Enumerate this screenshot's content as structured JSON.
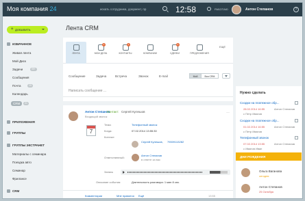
{
  "header": {
    "logo_text": "Моя компания",
    "logo_number": "24",
    "search_placeholder": "искать сотрудника, документ, пр",
    "time": "12:58",
    "work_status": "РАБОТАЮ",
    "user_name": "Антон Степанов",
    "help_glyph": "?"
  },
  "sidebar": {
    "add_button": "ДОБАВИТЬ",
    "favorites_label": "ИЗБРАННОЕ",
    "items": [
      {
        "label": "Живая лента"
      },
      {
        "label": "Мой Диск"
      },
      {
        "label": "Задачи",
        "badge": "99+"
      },
      {
        "label": "Сообщения"
      },
      {
        "label": "Почта",
        "badge": "19"
      },
      {
        "label": "Календарь"
      }
    ],
    "active_item": "CRM",
    "active_badge": "21",
    "groups": [
      {
        "label": "ПРИЛОЖЕНИЯ"
      },
      {
        "label": "ГРУППЫ"
      },
      {
        "label": "ГРУППЫ ЭКСТРАНЕТ"
      }
    ],
    "extranet_items": [
      {
        "label": "Материалы с семинара"
      },
      {
        "label": "Поездка авто"
      },
      {
        "label": "Семинар"
      },
      {
        "label": "Фрилансе"
      }
    ],
    "crm_group": "CRM"
  },
  "main": {
    "title": "Лента CRM",
    "toolbar": [
      {
        "label": "ЛЕНТА",
        "badge": ""
      },
      {
        "label": "МОИ ДЕЛА",
        "badge": "2"
      },
      {
        "label": "КОНТАКТЫ",
        "badge": "1"
      },
      {
        "label": "КОМПАНИИ",
        "badge": ""
      },
      {
        "label": "СДЕЛКИ",
        "badge": "4"
      },
      {
        "label": "ПРЕДЛОЖЕНИЯ",
        "badge": ""
      }
    ],
    "toolbar_more": "ЕЩЁ",
    "filter_tabs": [
      "Сообщение",
      "Задача",
      "Встреча",
      "Звонок",
      "E-mail"
    ],
    "seg_all": "Мой",
    "seg_all2": "Вся CRM",
    "compose_placeholder": "Написать сообщение ...",
    "post": {
      "author": "Антон Степанов",
      "contact_label": "Контакт:",
      "contact_name": "Сергей Кулешов",
      "subtitle": "Входящий звонок",
      "calendar_day": "7",
      "fields": {
        "topic_label": "Тема:",
        "topic_value": "Телефонный звонок",
        "when_label": "Когда:",
        "when_value": "07.02.2014 13:55:30",
        "contact_label": "Контакт:",
        "contact_name": "Сергей Кулешов,",
        "contact_phone": "79009113282",
        "responsible_label": "Ответственный:",
        "responsible_name": "Антон Степанов",
        "responsible_sub": "в ответе за вас",
        "record_label": "Запись",
        "desc_label": "Описание события:",
        "desc_value": "Длительность разговора: 1 мин 8 сек."
      },
      "footer": {
        "comments": "Комментарии",
        "like": "Мне нравится",
        "more": "Ещё",
        "time": "13:55"
      }
    }
  },
  "right_panel": {
    "todo_title": "Нужно сделать",
    "todos": [
      {
        "title": "Сходки на платежное обр...",
        "date": "28.02.2014 16:55",
        "owner": "Антон Степанов",
        "with": "с Петр Иванов"
      },
      {
        "title": "Сходки на платежное обр...",
        "date": "01.02.2014 16:55",
        "owner": "Антон Степанов",
        "with": "с Петр Иванов"
      },
      {
        "title": "Телефонный звонок",
        "date": "07.02.2014 13:55",
        "owner": "Антон Степанов",
        "with": "с Иванов Иван"
      }
    ],
    "birthdays_title": "ДНИ РОЖДЕНИЯ",
    "birthdays": [
      {
        "name": "Ольга Ваганова",
        "date": "сегодня"
      },
      {
        "name": "Антон Степанов",
        "date": "25 Октября"
      }
    ]
  }
}
